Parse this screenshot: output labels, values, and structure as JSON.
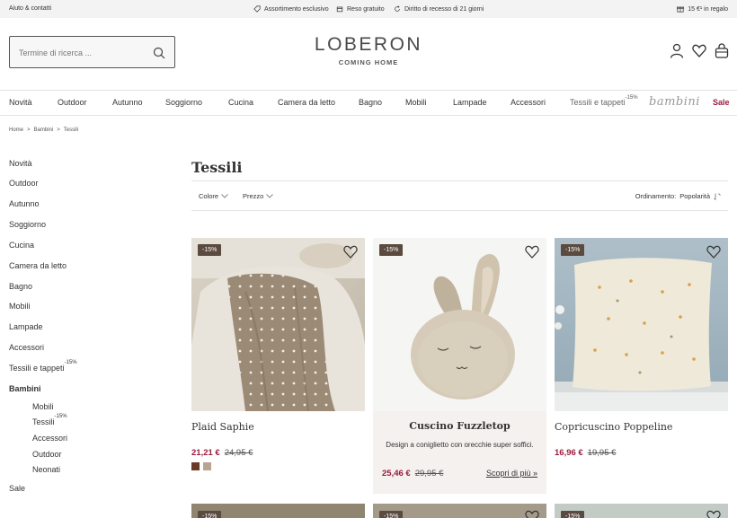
{
  "topbar": {
    "help": "Aiuto & contatti",
    "usps": [
      {
        "icon": "tag-icon",
        "label": "Assortimento esclusivo"
      },
      {
        "icon": "box-icon",
        "label": "Reso gratuito"
      },
      {
        "icon": "return-icon",
        "label": "Diritto di recesso di 21 giorni"
      }
    ],
    "gift": "15 €¹ in regalo"
  },
  "header": {
    "search_placeholder": "Termine di ricerca ...",
    "brand": "LOBERON",
    "tagline": "COMING HOME"
  },
  "nav": {
    "items": [
      "Novità",
      "Outdoor",
      "Autunno",
      "Soggiorno",
      "Cucina",
      "Camera da letto",
      "Bagno",
      "Mobili",
      "Lampade",
      "Accessori"
    ],
    "textiles": "Tessili e tappeti",
    "textiles_badge": "-15%",
    "bambini": "bambini",
    "sale": "Sale"
  },
  "breadcrumb": {
    "items": [
      "Home",
      "Bambini",
      "Tessili"
    ],
    "separator": ">"
  },
  "sidebar": {
    "items": [
      "Novità",
      "Outdoor",
      "Autunno",
      "Soggiorno",
      "Cucina",
      "Camera da letto",
      "Bagno",
      "Mobili",
      "Lampade",
      "Accessori"
    ],
    "textiles": "Tessili e tappeti",
    "textiles_badge": "-15%",
    "active": "Bambini",
    "sub": [
      "Mobili",
      "Tessili",
      "Accessori",
      "Outdoor",
      "Neonati"
    ],
    "sub_badge": "-15%",
    "sale": "Sale"
  },
  "main": {
    "title": "Tessili",
    "filters": [
      "Colore",
      "Prezzo"
    ],
    "sort_label": "Ordinamento:",
    "sort_value": "Popolarità"
  },
  "products": [
    {
      "badge": "-15%",
      "name": "Plaid Saphie",
      "price": "21,21 €",
      "old_price": "24,95 €",
      "swatches": [
        "#6b3a26",
        "#b8a590"
      ]
    },
    {
      "badge": "-15%",
      "name": "Cuscino Fuzzletop",
      "desc": "Design a coniglietto con orecchie super soffici.",
      "price": "25,46 €",
      "old_price": "29,95 €",
      "more": "Scopri di più »"
    },
    {
      "badge": "-15%",
      "name": "Copricuscino Poppeline",
      "price": "16,96 €",
      "old_price": "19,95 €"
    }
  ],
  "row2_badges": [
    "-15%",
    "-15%",
    "-15%"
  ],
  "colors": {
    "accent": "#9b1b3f",
    "badge": "#5a4a3f"
  }
}
